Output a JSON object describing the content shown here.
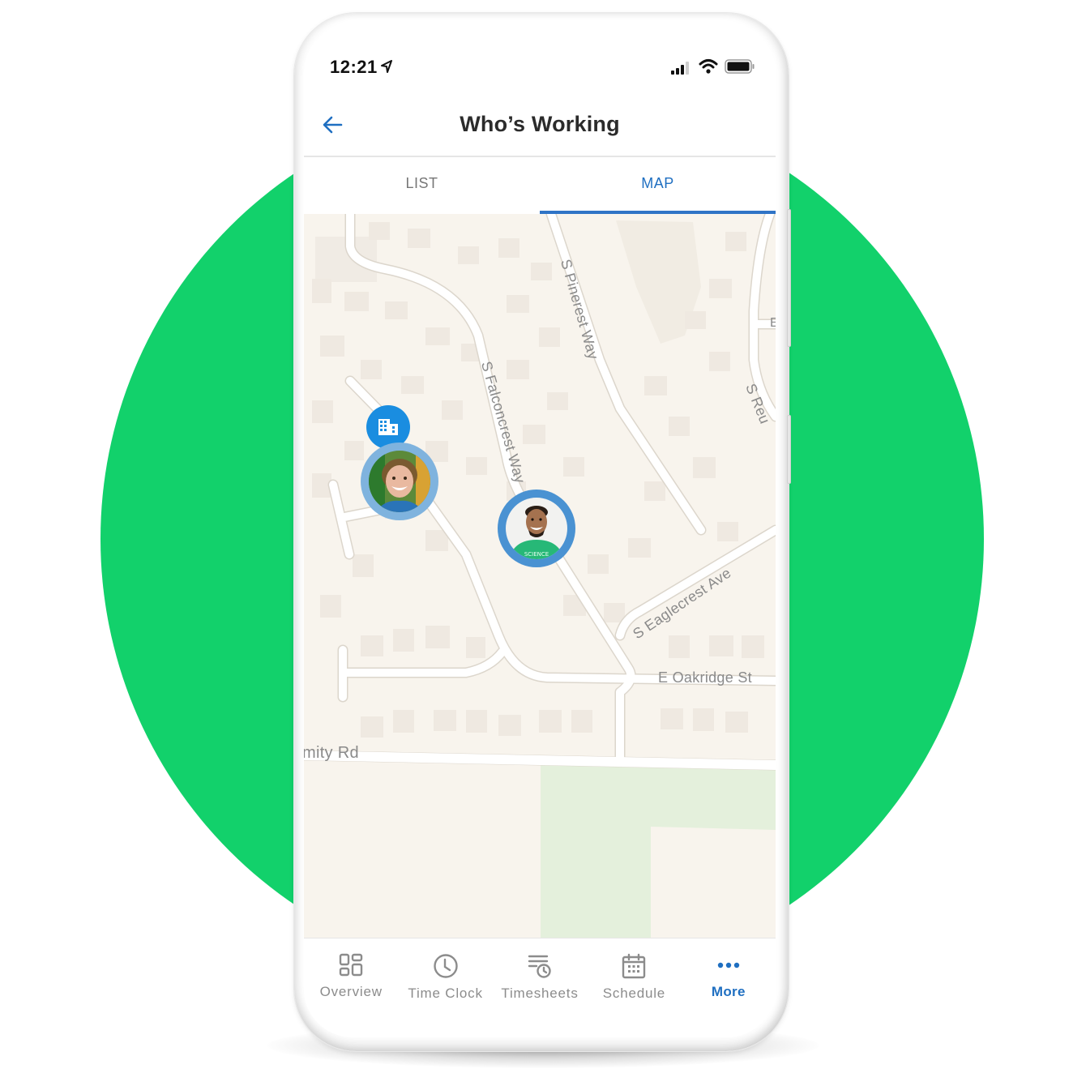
{
  "status_bar": {
    "time": "12:21",
    "icons": [
      "location-arrow-icon",
      "cellular-signal-icon",
      "wifi-icon",
      "battery-icon"
    ]
  },
  "header": {
    "title": "Who’s Working",
    "back_icon": "arrow-left-icon"
  },
  "tabs": [
    {
      "label": "LIST",
      "active": false
    },
    {
      "label": "MAP",
      "active": true
    }
  ],
  "map": {
    "streets": [
      {
        "label": "S Falconcrest Way"
      },
      {
        "label": "S Pinerest Way"
      },
      {
        "label": "S Eaglecrest Ave"
      },
      {
        "label": "E Oakridge St"
      },
      {
        "label": "Amity Rd",
        "visible_text": "mity Rd"
      },
      {
        "label": "S Reu",
        "visible_text": "S Reu"
      },
      {
        "label": "E",
        "visible_text": "E"
      }
    ],
    "markers": [
      {
        "type": "location",
        "icon": "building-icon"
      },
      {
        "type": "employee",
        "description": "woman smiling, blue shirt"
      },
      {
        "type": "employee",
        "description": "man smiling, green SCIENCE t-shirt",
        "shirt_text": "SCIENCE"
      }
    ]
  },
  "bottom_nav": [
    {
      "label": "Overview",
      "icon": "dashboard-icon",
      "active": false
    },
    {
      "label": "Time Clock",
      "icon": "clock-icon",
      "active": false
    },
    {
      "label": "Timesheets",
      "icon": "timesheet-icon",
      "active": false
    },
    {
      "label": "Schedule",
      "icon": "calendar-icon",
      "active": false
    },
    {
      "label": "More",
      "icon": "more-dots-icon",
      "active": true
    }
  ],
  "colors": {
    "accent": "#1f6fc1",
    "background_circle": "#12d16b",
    "map_marker": "#1a8de0",
    "map_land": "#f8f4ed",
    "park": "#e4f0dc"
  }
}
